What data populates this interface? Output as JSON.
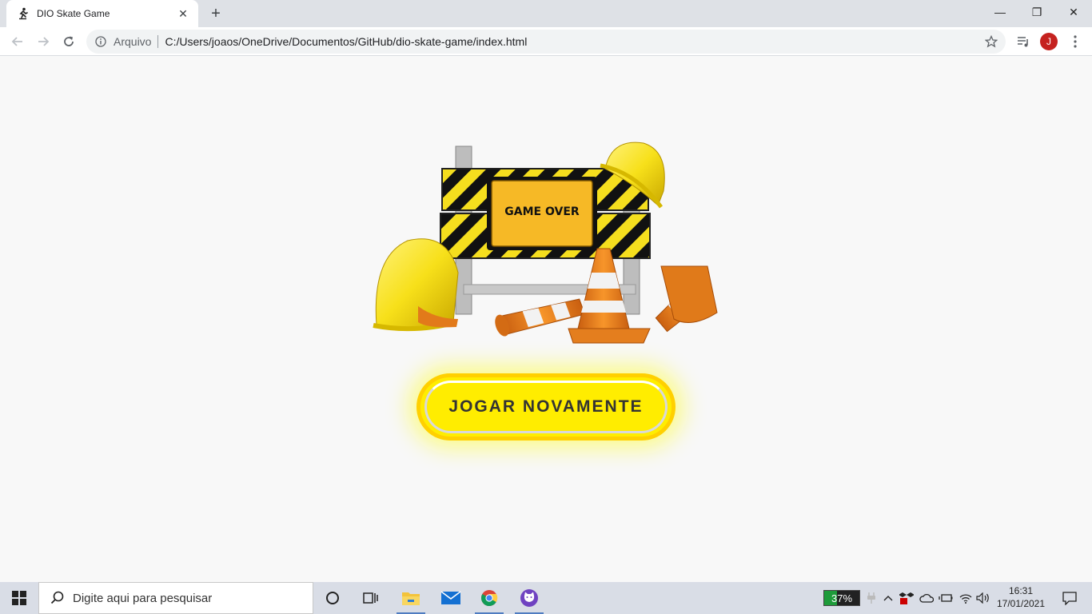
{
  "browser": {
    "tab": {
      "title": "DIO Skate Game",
      "close_glyph": "✕",
      "favicon": "skater-icon"
    },
    "new_tab_glyph": "+",
    "window_controls": {
      "minimize": "—",
      "restore": "❐",
      "close": "✕"
    },
    "omnibox": {
      "security_label": "Arquivo",
      "url": "C:/Users/joaos/OneDrive/Documentos/GitHub/dio-skate-game/index.html"
    },
    "profile_initial": "J"
  },
  "page": {
    "sign_text": "GAME OVER",
    "replay_button": "JOGAR NOVAMENTE"
  },
  "taskbar": {
    "search_placeholder": "Digite aqui para pesquisar",
    "battery_percent": "37%",
    "clock_time": "16:31",
    "clock_date": "17/01/2021"
  }
}
